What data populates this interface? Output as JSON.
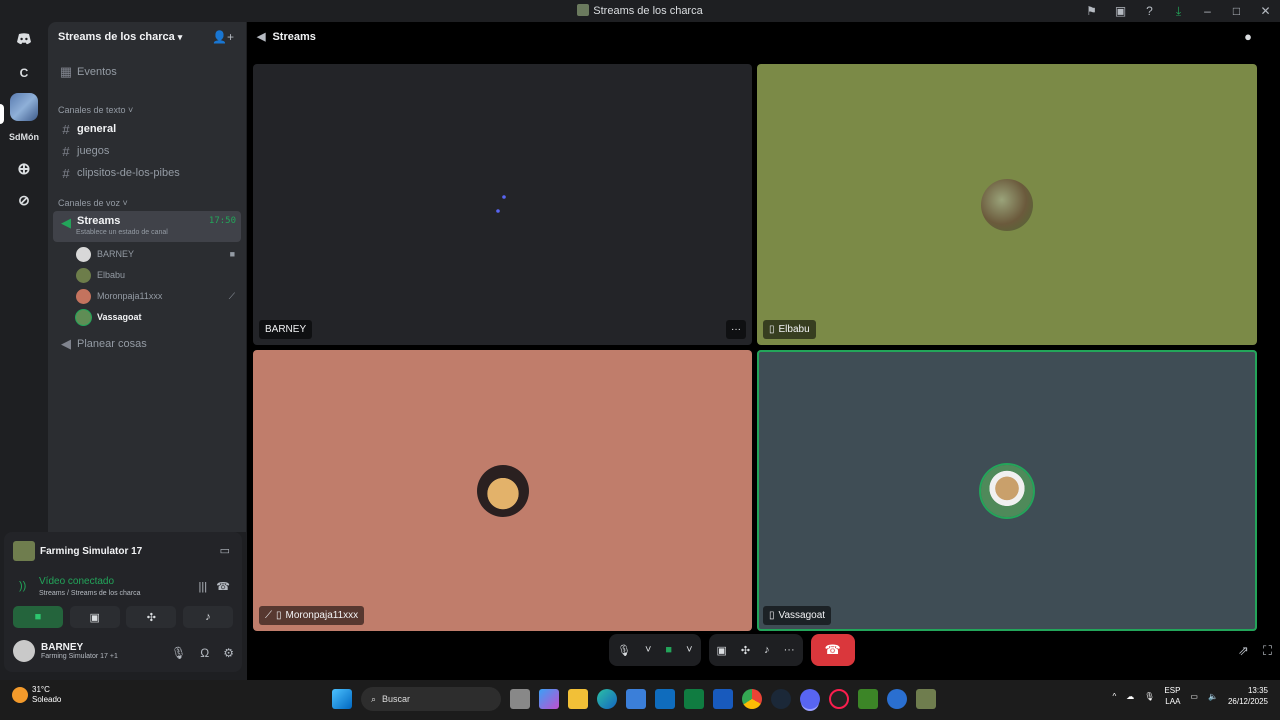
{
  "window": {
    "title": "Streams de los charca"
  },
  "rail": {
    "discord_label": "Discord",
    "c_label": "C",
    "server_label": "SdMón"
  },
  "sidebar": {
    "server_name": "Streams de los charca",
    "events": "Eventos",
    "text_category": "Canales de texto",
    "text_channels": [
      "general",
      "juegos",
      "clipsitos-de-los-pibes"
    ],
    "voice_category": "Canales de voz",
    "active_voice": {
      "name": "Streams",
      "time": "17:50",
      "status": "Establece un estado de canal"
    },
    "voice_users": [
      "BARNEY",
      "Elbabu",
      "Moronpaja11xxx",
      "Vassagoat"
    ],
    "other_voice": "Planear cosas"
  },
  "panel": {
    "game": "Farming Simulator 17",
    "vc_status": "Vídeo conectado",
    "vc_sub": "Streams / Streams de los charca",
    "me_name": "BARNEY",
    "me_status": "Farming Simulator 17 +1"
  },
  "stage": {
    "channel": "Streams",
    "tiles": [
      {
        "name": "BARNEY",
        "bg": "#232428"
      },
      {
        "name": "Elbabu",
        "bg": "#7b8a47"
      },
      {
        "name": "Moronpaja11xxx",
        "bg": "#c07d6b"
      },
      {
        "name": "Vassagoat",
        "bg": "#3f4d55"
      }
    ]
  },
  "taskbar": {
    "temp": "31°C",
    "weather": "Soleado",
    "search": "Buscar",
    "lang1": "ESP",
    "lang2": "LAA",
    "time": "13:35",
    "date": "26/12/2025"
  },
  "colors": {
    "accent_green": "#23a55a",
    "end_call": "#da373c"
  },
  "icons": [
    "discord-icon",
    "speaker-icon",
    "hash-icon",
    "camera-icon",
    "phone-icon",
    "windows-icon",
    "search-icon"
  ]
}
